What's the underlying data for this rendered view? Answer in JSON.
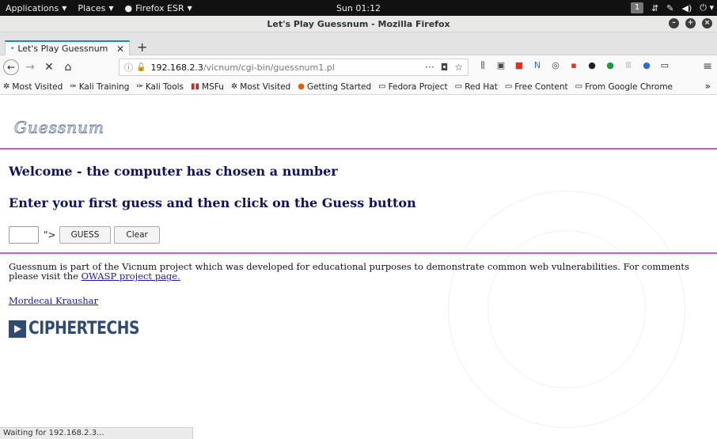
{
  "topbar": {
    "applications": "Applications",
    "places": "Places",
    "firefox": "Firefox ESR",
    "clock": "Sun 01:12",
    "workspace": "1"
  },
  "window": {
    "title": "Let's Play Guessnum - Mozilla Firefox"
  },
  "tabs": [
    {
      "title": "Let's Play Guessnum",
      "active": true
    }
  ],
  "urlbar": {
    "host": "192.168.2.3",
    "path": "/vicnum/cgi-bin/guessnum1.pl"
  },
  "bookmarks": [
    {
      "label": "Most Visited",
      "icon": "gear-icon"
    },
    {
      "label": "Kali Training",
      "icon": "kali-icon"
    },
    {
      "label": "Kali Tools",
      "icon": "kali-icon"
    },
    {
      "label": "MSFu",
      "icon": "msf-icon"
    },
    {
      "label": "Most Visited",
      "icon": "gear-icon"
    },
    {
      "label": "Getting Started",
      "icon": "firefox-icon"
    },
    {
      "label": "Fedora Project",
      "icon": "folder-icon"
    },
    {
      "label": "Red Hat",
      "icon": "folder-icon"
    },
    {
      "label": "Free Content",
      "icon": "folder-icon"
    },
    {
      "label": "From Google Chrome",
      "icon": "folder-icon"
    }
  ],
  "page": {
    "logo": "Guessnum",
    "heading1": "Welcome - the computer has chosen a number",
    "heading2": "Enter your first guess and then click on the Guess button",
    "stray_text": "\">",
    "guess_button": "GUESS",
    "clear_button": "Clear",
    "info_text": "Guessnum is part of the Vicnum project which was developed for educational purposes to demonstrate common web vulnerabilities. For comments please visit the",
    "owasp_link": "OWASP project page.",
    "author_link": "Mordecai Kraushar",
    "ciphertechs": "CIPHERTECHS",
    "colors": {
      "rule": "#d455d0",
      "heading": "#101060",
      "link": "#1a1aa6"
    }
  },
  "status": {
    "text": "Waiting for 192.168.2.3..."
  }
}
